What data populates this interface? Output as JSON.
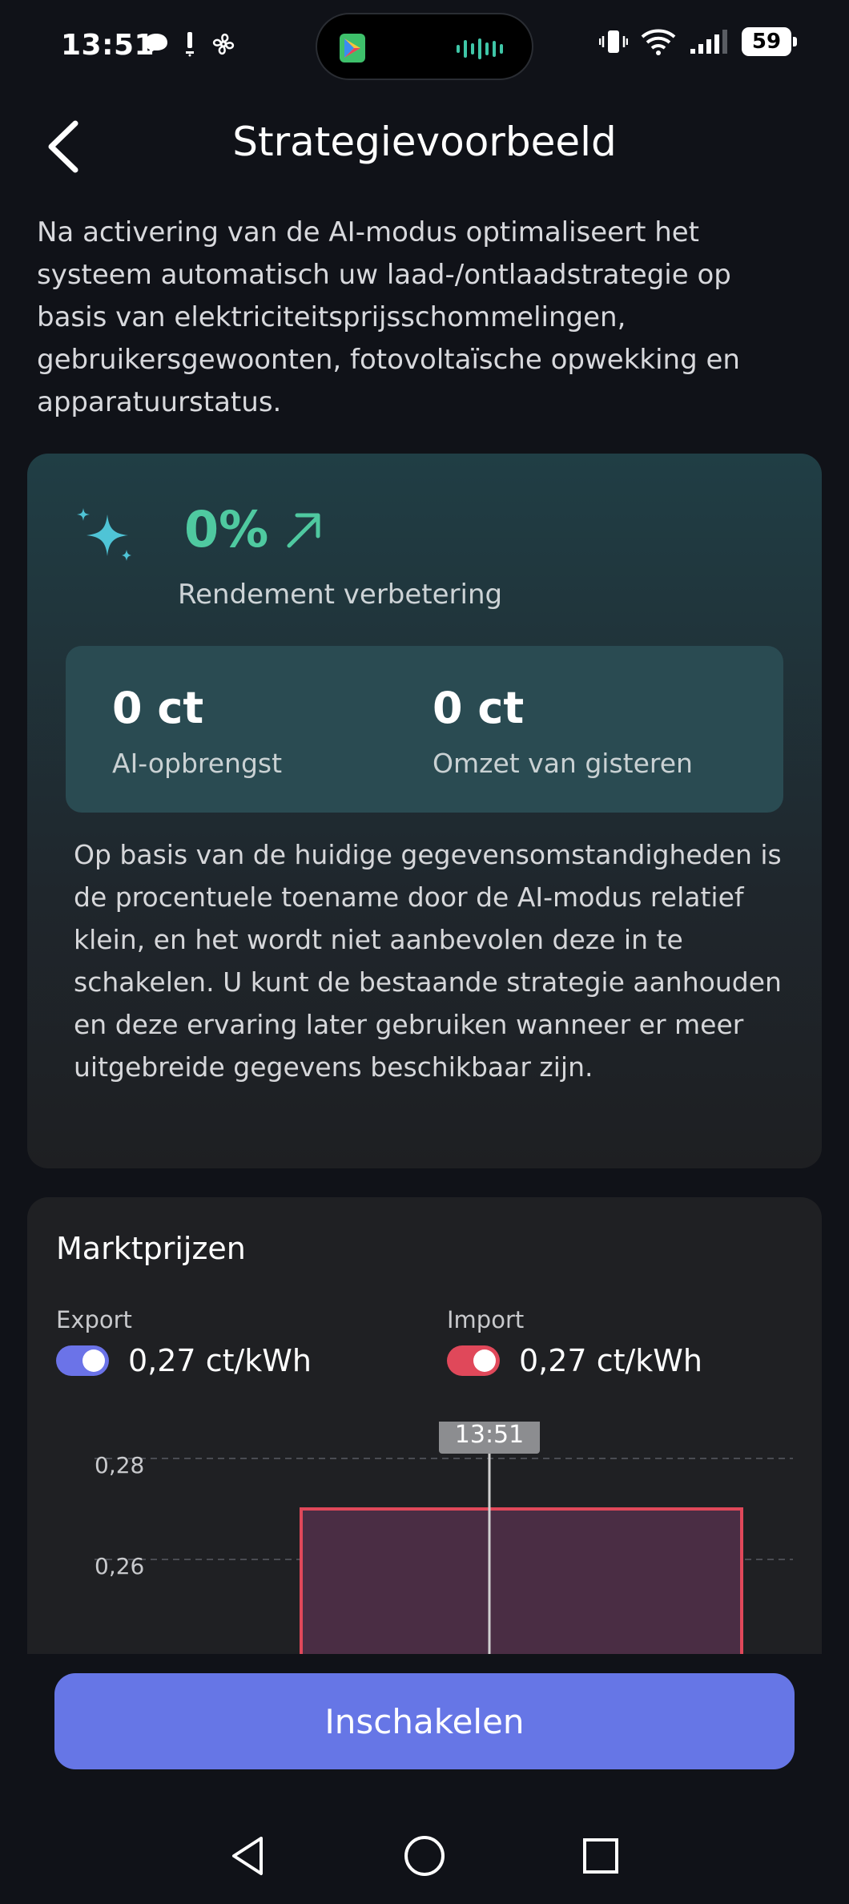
{
  "status_bar": {
    "time": "13:51",
    "battery": "59"
  },
  "header": {
    "title": "Strategievoorbeeld"
  },
  "intro": {
    "text": "Na activering van de AI-modus optimaliseert het systeem automatisch uw laad-/ontlaadstrategie op basis van elektriciteitsprijsschommelingen, gebruikersgewoonten, fotovoltaïsche opwekking en apparatuurstatus."
  },
  "ai_card": {
    "efficiency_value": "0%",
    "efficiency_label": "Rendement verbetering",
    "stats": [
      {
        "value": "0 ct",
        "label": "AI-opbrengst"
      },
      {
        "value": "0 ct",
        "label": "Omzet van gisteren"
      }
    ],
    "note": "Op basis van de huidige gegevensomstandigheden is de procentuele toename door de AI-modus relatief klein, en het wordt niet aanbevolen deze in te schakelen. U kunt de bestaande strategie aanhouden en deze ervaring later gebruiken wanneer er meer uitgebreide gegevens beschikbaar zijn.",
    "accent_color": "#4fc9a0"
  },
  "market": {
    "title": "Marktprijzen",
    "export": {
      "label": "Export",
      "value": "0,27 ct/kWh",
      "enabled": true,
      "color": "#6b73e8"
    },
    "import": {
      "label": "Import",
      "value": "0,27 ct/kWh",
      "enabled": true,
      "color": "#e0485a"
    }
  },
  "chart_data": {
    "type": "bar",
    "y_tick_labels": [
      "0,28",
      "0,26"
    ],
    "y_ticks": [
      0.28,
      0.26
    ],
    "cursor_label": "13:51",
    "series": [
      {
        "values": [
          0.27
        ],
        "color": "#e0485a"
      }
    ],
    "grid": true
  },
  "actions": {
    "enable_label": "Inschakelen",
    "button_color": "#6676e6"
  }
}
